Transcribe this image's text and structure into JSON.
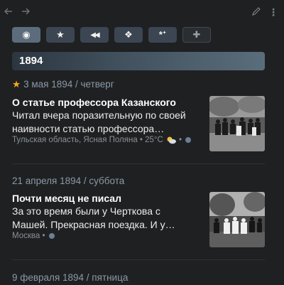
{
  "toolbar": {
    "back_icon": "arrow-left-icon",
    "forward_icon": "arrow-right-icon",
    "edit_icon": "pencil-icon",
    "more_icon": "more-vertical-icon"
  },
  "filters": [
    {
      "icon": "target-icon",
      "glyph": "◉"
    },
    {
      "icon": "star-icon",
      "glyph": "★"
    },
    {
      "icon": "rewind-icon",
      "glyph": "◀◀"
    },
    {
      "icon": "diamond-cluster-icon",
      "glyph": "❖"
    },
    {
      "icon": "asterisk-icon",
      "glyph": "*ᐩ"
    },
    {
      "icon": "plus-icon",
      "glyph": "✚"
    }
  ],
  "year": "1894",
  "entries": [
    {
      "date": "3 мая 1894 / четверг",
      "starred": true,
      "title": "О статье профессора Казанского",
      "text": "Читал вчера поразительную по своей наивности статью профессора…",
      "location": "Тульская область, Ясная Поляна",
      "temperature": "25°C",
      "weather_icon": "partly-cloudy-icon"
    },
    {
      "date": "21 апреля 1894 / суббота",
      "starred": false,
      "title": "Почти месяц не писал",
      "text": "За это время были у Черткова с Машей. Прекрасная поездка. И у…",
      "location": "Москва"
    },
    {
      "date": "9 февраля 1894 / пятница"
    }
  ],
  "colors": {
    "background": "#1f2022",
    "accent_star": "#f3a81d",
    "date_text": "#8a9aa6"
  }
}
